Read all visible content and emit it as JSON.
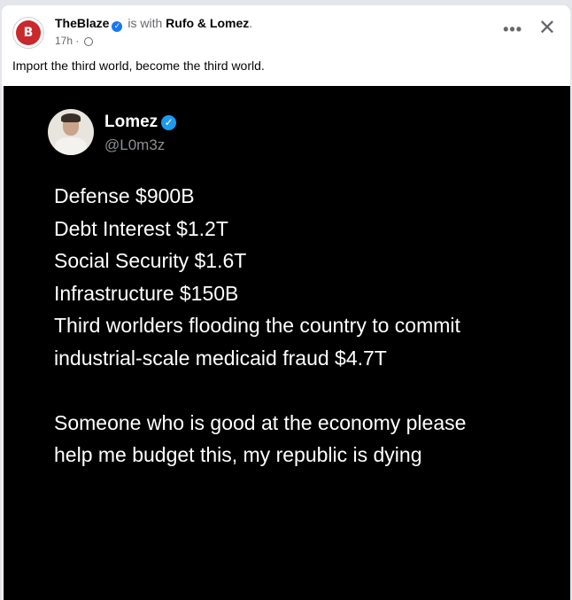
{
  "post": {
    "page_name": "TheBlaze",
    "with_text": "is with",
    "tagged": "Rufo & Lomez",
    "period": ".",
    "time": "17h",
    "caption": "Import the third world, become the third world."
  },
  "tweet": {
    "name": "Lomez",
    "handle": "@L0m3z",
    "lines": [
      "Defense $900B",
      "Debt Interest $1.2T",
      "Social Security $1.6T",
      "Infrastructure $150B",
      "Third worlders flooding the country to commit",
      "industrial-scale medicaid fraud $4.7T"
    ],
    "closing": [
      "Someone who is good at the economy please",
      "help me budget this, my republic is dying"
    ]
  },
  "colors": {
    "brand": "#c9282d",
    "verified": "#1877f2",
    "tweet_bg": "#000000"
  }
}
